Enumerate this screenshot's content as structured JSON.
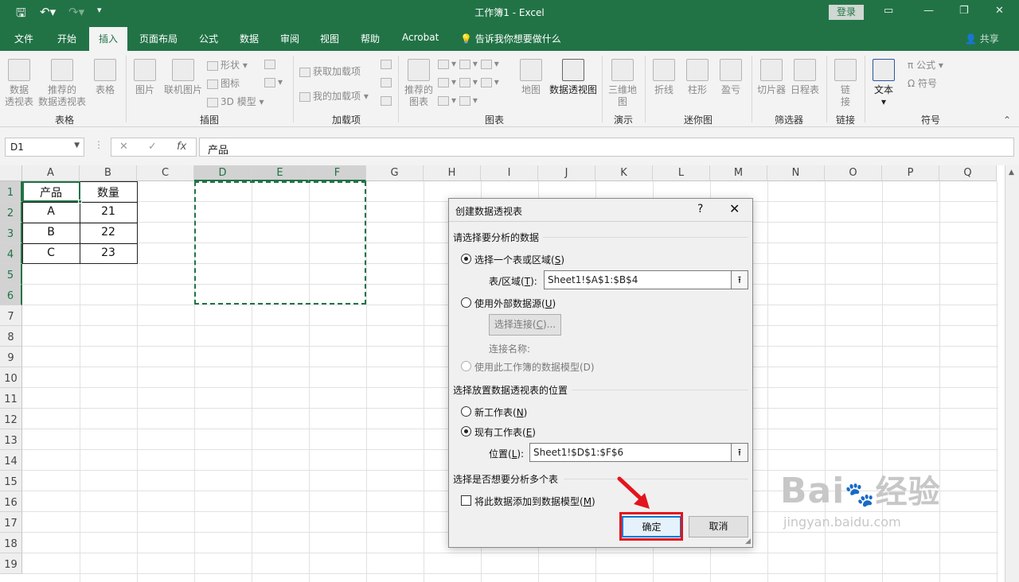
{
  "app": {
    "title": "工作簿1  -  Excel",
    "login": "登录",
    "share": "共享"
  },
  "tabs": [
    "文件",
    "开始",
    "插入",
    "页面布局",
    "公式",
    "数据",
    "审阅",
    "视图",
    "帮助",
    "Acrobat"
  ],
  "tell_me": "告诉我你想要做什么",
  "ribbon": {
    "pivot": "数据\n透视表",
    "recommended_pivot": "推荐的\n数据透视表",
    "table": "表格",
    "picture": "图片",
    "online_picture": "联机图片",
    "shapes": "形状",
    "icons": "图标",
    "model3d": "3D 模型",
    "get_addins": "获取加载项",
    "my_addins": "我的加载项",
    "recommended_charts": "推荐的\n图表",
    "map": "地图",
    "pivot_chart": "数据透视图",
    "map3d": "三维地\n图",
    "line": "折线",
    "column": "柱形",
    "winloss": "盈亏",
    "slicer": "切片器",
    "timeline": "日程表",
    "link": "链\n接",
    "text": "文本",
    "equation": "公式",
    "symbol": "符号",
    "groups": {
      "tables": "表格",
      "illustrations": "插图",
      "addins": "加载项",
      "charts": "图表",
      "tours": "演示",
      "sparklines": "迷你图",
      "filters": "筛选器",
      "links": "链接",
      "symbols": "符号"
    }
  },
  "formula_bar": {
    "name_box": "D1",
    "formula": "产品"
  },
  "sheet": {
    "columns": [
      "A",
      "B",
      "C",
      "D",
      "E",
      "F",
      "G",
      "H",
      "I",
      "J",
      "K",
      "L",
      "M",
      "N",
      "O",
      "P",
      "Q"
    ],
    "rows": [
      "1",
      "2",
      "3",
      "4",
      "5",
      "6",
      "7",
      "8",
      "9",
      "10",
      "11",
      "12",
      "13",
      "14",
      "15",
      "16",
      "17",
      "18",
      "19"
    ],
    "cells": {
      "A1": "产品",
      "B1": "数量",
      "A2": "A",
      "B2": "21",
      "A3": "B",
      "B3": "22",
      "A4": "C",
      "B4": "23"
    }
  },
  "dialog": {
    "title": "创建数据透视表",
    "help": "?",
    "close": "✕",
    "section1": "请选择要分析的数据",
    "opt_table": "选择一个表或区域(",
    "opt_table_key": "S",
    "range_label": "表/区域(",
    "range_key": "T",
    "range_value": "Sheet1!$A$1:$B$4",
    "opt_external": "使用外部数据源(",
    "opt_external_key": "U",
    "choose_conn": "选择连接(",
    "choose_conn_key": "C",
    "conn_name": "连接名称:",
    "opt_datamodel": "使用此工作簿的数据模型(D)",
    "section2": "选择放置数据透视表的位置",
    "opt_new_sheet": "新工作表(",
    "opt_new_sheet_key": "N",
    "opt_existing": "现有工作表(",
    "opt_existing_key": "E",
    "location_label": "位置(",
    "location_key": "L",
    "location_value": "Sheet1!$D$1:$F$6",
    "section3": "选择是否想要分析多个表",
    "add_to_model": "将此数据添加到数据模型(",
    "add_to_model_key": "M",
    "ok": "确定",
    "cancel": "取消"
  },
  "watermark": {
    "brand_left": "Bai",
    "brand_right": "经验",
    "url": "jingyan.baidu.com"
  },
  "colors": {
    "excel_green": "#217346",
    "highlight_red": "#e3141e"
  }
}
